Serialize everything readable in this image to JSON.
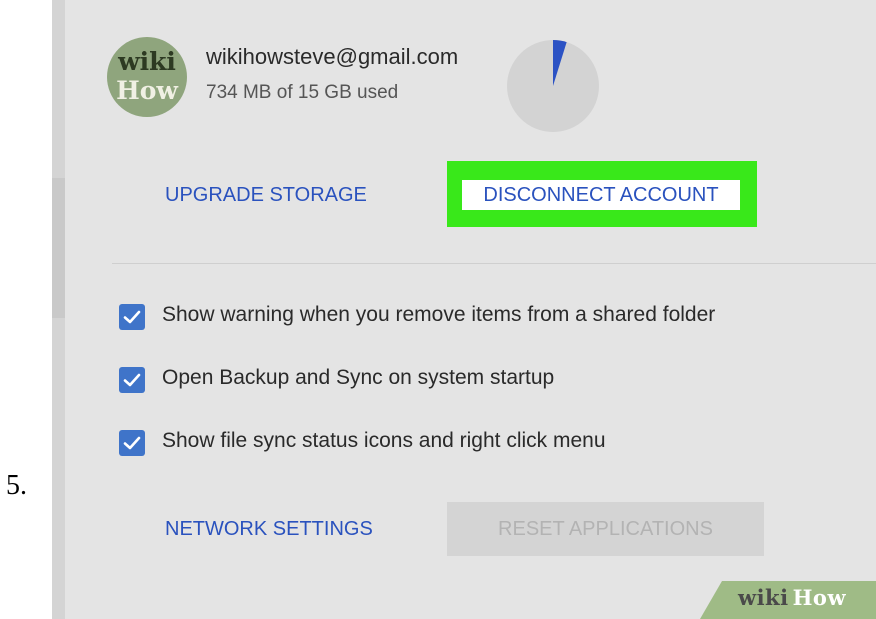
{
  "step": {
    "number": "5."
  },
  "account": {
    "avatar_line1": "wiki",
    "avatar_line2": "How",
    "email": "wikihowsteve@gmail.com",
    "usage": "734 MB of 15 GB used",
    "usage_fraction": 0.048
  },
  "actions": {
    "upgrade_label": "UPGRADE STORAGE",
    "disconnect_label": "DISCONNECT ACCOUNT"
  },
  "options": [
    {
      "label": "Show warning when you remove items from a shared folder",
      "checked": true
    },
    {
      "label": "Open Backup and Sync on system startup",
      "checked": true
    },
    {
      "label": "Show file sync status icons and right click menu",
      "checked": true
    }
  ],
  "footer": {
    "network_label": "NETWORK SETTINGS",
    "reset_label": "RESET APPLICATIONS"
  },
  "watermark": {
    "part1": "wiki",
    "part2": "How"
  },
  "colors": {
    "panel_bg": "#e4e4e4",
    "link": "#2a52be",
    "highlight": "#39e81a",
    "checkbox": "#3f74c9",
    "pie_used": "#2b52c4",
    "pie_bg": "#d3d3d3",
    "watermark_bg": "#9fbb86"
  }
}
